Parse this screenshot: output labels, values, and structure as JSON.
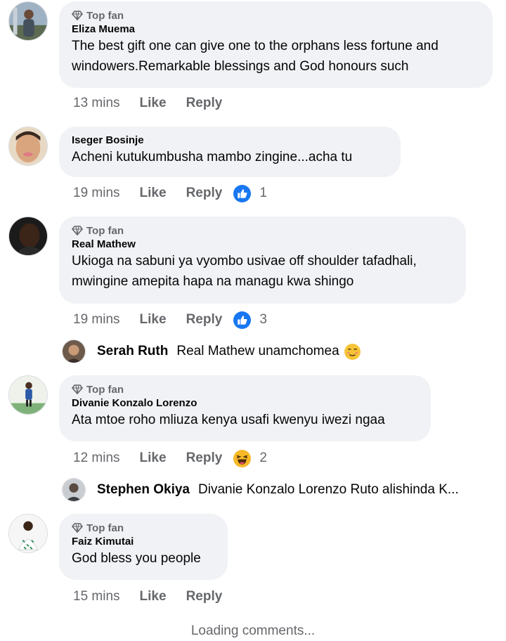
{
  "comments": [
    {
      "top_fan": "Top fan",
      "author": "Eliza Muema",
      "text_lines": [
        "The best gift one can give one to the orphans less fortune and",
        "windowers.Remarkable blessings and God honours such"
      ],
      "time": "13 mins",
      "like": "Like",
      "reply": "Reply"
    },
    {
      "author": "Iseger Bosinje",
      "text_lines": [
        "Acheni kutukumbusha mambo zingine...acha tu"
      ],
      "time": "19 mins",
      "like": "Like",
      "reply": "Reply",
      "reaction_icon": "like-reaction-icon",
      "reaction_count": "1"
    },
    {
      "top_fan": "Top fan",
      "author": "Real Mathew",
      "text_lines": [
        "Ukioga na sabuni ya vyombo usivae off shoulder tafadhali,",
        "mwingine amepita hapa na managu kwa shingo"
      ],
      "time": "19 mins",
      "like": "Like",
      "reply": "Reply",
      "reaction_icon": "like-reaction-icon",
      "reaction_count": "3",
      "reply_preview": {
        "name": "Serah Ruth",
        "text": "Real Mathew unamchomea",
        "emoji": "blushing-face-emoji"
      }
    },
    {
      "top_fan": "Top fan",
      "author": "Divanie Konzalo Lorenzo",
      "text_lines": [
        "Ata mtoe roho mliuza kenya usafi kwenyu iwezi ngaa"
      ],
      "time": "12 mins",
      "like": "Like",
      "reply": "Reply",
      "reaction_icon": "haha-reaction-icon",
      "reaction_count": "2",
      "reply_preview": {
        "name": "Stephen Okiya",
        "text": "Divanie Konzalo Lorenzo Ruto alishinda K..."
      }
    },
    {
      "top_fan": "Top fan",
      "author": "Faiz Kimutai",
      "text_lines": [
        "God bless you people"
      ],
      "time": "15 mins",
      "like": "Like",
      "reply": "Reply"
    }
  ],
  "loading_text": "Loading comments...",
  "colors": {
    "bubble": "#f0f2f5",
    "meta": "#65676b",
    "like_blue": "#1877f2",
    "haha_yellow": "#f7b928"
  }
}
